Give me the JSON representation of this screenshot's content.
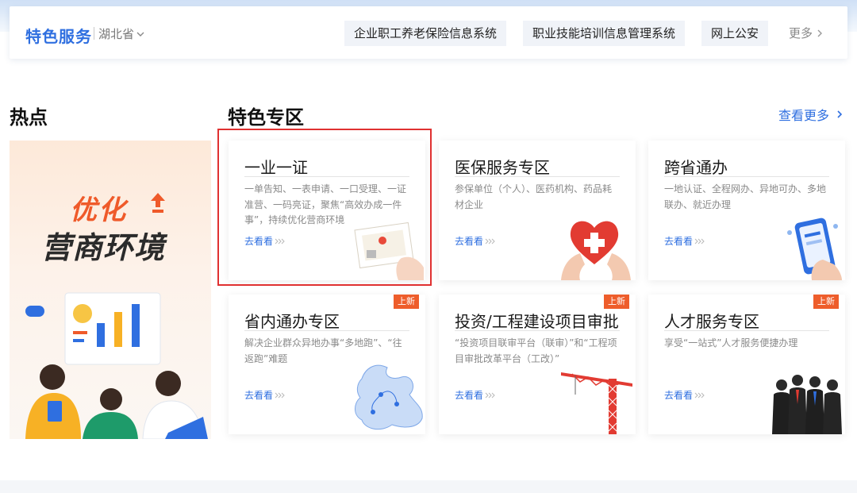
{
  "header": {
    "brand": "特色服务",
    "region": "湖北省",
    "links": [
      {
        "label": "企业职工养老保险信息系统"
      },
      {
        "label": "职业技能培训信息管理系统"
      },
      {
        "label": "网上公安"
      }
    ],
    "more": "更多"
  },
  "hot": {
    "title": "热点",
    "banner": {
      "line1": "优化",
      "line2": "营商环境"
    }
  },
  "featured": {
    "title": "特色专区",
    "more_label": "查看更多",
    "cards": [
      {
        "title": "一业一证",
        "desc": "一单告知、一表申请、一口受理、一证准营、一码亮证，聚焦“高效办成一件事”，持续优化营商环境",
        "go": "去看看",
        "badge": "",
        "art": "certificate-illustration"
      },
      {
        "title": "医保服务专区",
        "desc": "参保单位（个人）、医药机构、药品耗材企业",
        "go": "去看看",
        "badge": "",
        "art": "medical-hands-illustration"
      },
      {
        "title": "跨省通办",
        "desc": "一地认证、全程网办、异地可办、多地联办、就近办理",
        "go": "去看看",
        "badge": "",
        "art": "phone-hand-illustration"
      },
      {
        "title": "省内通办专区",
        "desc": "解决企业群众异地办事“多地跑”、“往返跑”难题",
        "go": "去看看",
        "badge": "上新",
        "art": "map-illustration"
      },
      {
        "title": "投资/工程建设项目审批",
        "desc": "“投资项目联审平台（联审）”和“工程项目审批改革平台（工改）”",
        "go": "去看看",
        "badge": "上新",
        "art": "crane-illustration"
      },
      {
        "title": "人才服务专区",
        "desc": "享受“一站式”人才服务便捷办理",
        "go": "去看看",
        "badge": "上新",
        "art": "team-illustration"
      }
    ]
  },
  "colors": {
    "accent": "#2f6fe0",
    "badge": "#ee5d2b",
    "highlight": "#e03131"
  }
}
